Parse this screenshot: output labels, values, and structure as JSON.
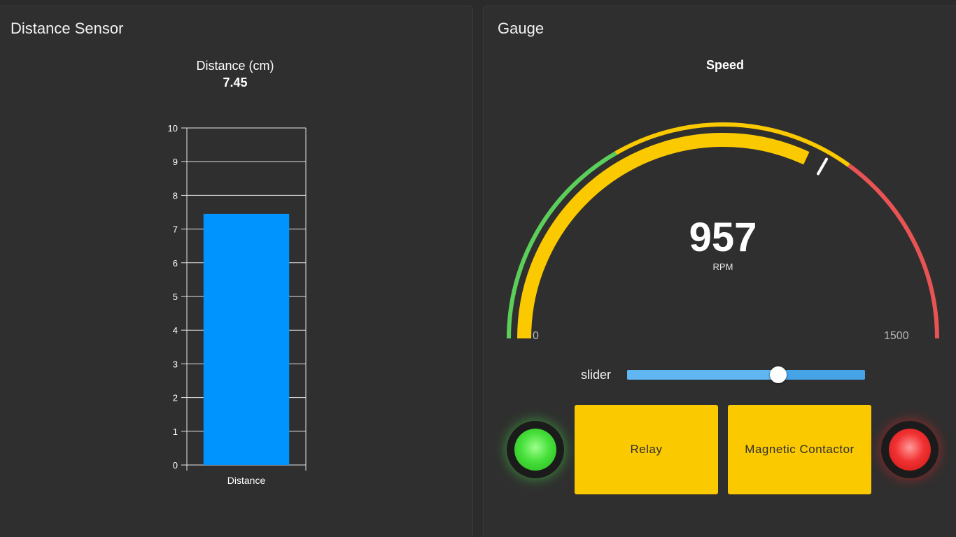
{
  "distance_panel": {
    "title": "Distance Sensor",
    "chart_header": {
      "label": "Distance (cm)",
      "value": "7.45"
    }
  },
  "gauge_panel": {
    "title": "Gauge",
    "gauge": {
      "title": "Speed",
      "value": 957,
      "value_text": "957",
      "units": "RPM",
      "min": 0,
      "max": 1500,
      "min_text": "0",
      "max_text": "1500",
      "segments": [
        {
          "from": 0,
          "to": 500,
          "color": "#5ccf5a"
        },
        {
          "from": 500,
          "to": 1050,
          "color": "#fbc900"
        },
        {
          "from": 1050,
          "to": 1500,
          "color": "#e85454"
        }
      ],
      "value_color": "#fbc900",
      "needle_value": 1000
    },
    "slider": {
      "label": "slider",
      "value_fraction": 0.635
    },
    "indicators": {
      "left": {
        "state": "on",
        "color": "green"
      },
      "right": {
        "state": "on",
        "color": "red"
      }
    },
    "buttons": {
      "relay": "Relay",
      "contactor": "Magnetic Contactor"
    }
  },
  "chart_data": {
    "type": "bar",
    "categories": [
      "Distance"
    ],
    "values": [
      7.45
    ],
    "title": "Distance (cm)",
    "subtitle": "7.45",
    "xlabel": "",
    "ylabel": "",
    "ylim": [
      0,
      10
    ],
    "yticks": [
      0,
      1,
      2,
      3,
      4,
      5,
      6,
      7,
      8,
      9,
      10
    ],
    "grid": true,
    "bar_color": "#0094ff",
    "legend": "none"
  }
}
